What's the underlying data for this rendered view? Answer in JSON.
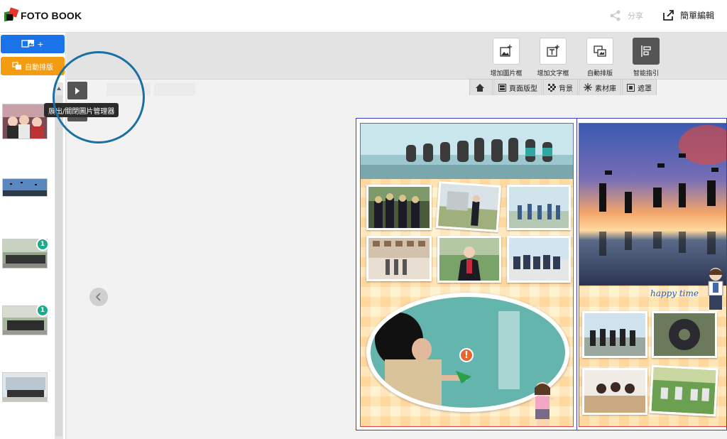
{
  "header": {
    "logo_text": "FOTO BOOK",
    "share_label": "分享",
    "simple_edit_label": "簡單編輯"
  },
  "sidebar": {
    "add_photo_label": "+",
    "auto_layout_label": "自動排版",
    "thumbnails": [
      {
        "name": "photo-friends",
        "badge": ""
      },
      {
        "name": "photo-cap-toss",
        "badge": ""
      },
      {
        "name": "photo-group-park",
        "badge": "1"
      },
      {
        "name": "photo-group-jump",
        "badge": "1"
      },
      {
        "name": "photo-building-group",
        "badge": ""
      }
    ]
  },
  "toolbar": {
    "tools": [
      {
        "label": "增加圖片框",
        "icon": "add-image-frame-icon"
      },
      {
        "label": "增加文字框",
        "icon": "add-text-frame-icon"
      },
      {
        "label": "自動排版",
        "icon": "auto-layout-icon"
      },
      {
        "label": "智能指引",
        "icon": "smart-guide-icon"
      }
    ],
    "tabs": [
      {
        "label": "",
        "icon": "home-icon"
      },
      {
        "label": "頁面版型",
        "icon": "page-layout-icon"
      },
      {
        "label": "背景",
        "icon": "background-icon"
      },
      {
        "label": "素材庫",
        "icon": "material-library-icon"
      },
      {
        "label": "遮罩",
        "icon": "mask-icon"
      }
    ]
  },
  "tooltip": {
    "text": "展出/關閉圖片管理器"
  },
  "book": {
    "right_page_caption": "happy time"
  },
  "colors": {
    "primary_blue": "#1a73e8",
    "auto_orange": "#f39c12",
    "badge_teal": "#1aaa8c",
    "highlight_ring": "#1b6fa3",
    "warning": "#e6662e"
  }
}
